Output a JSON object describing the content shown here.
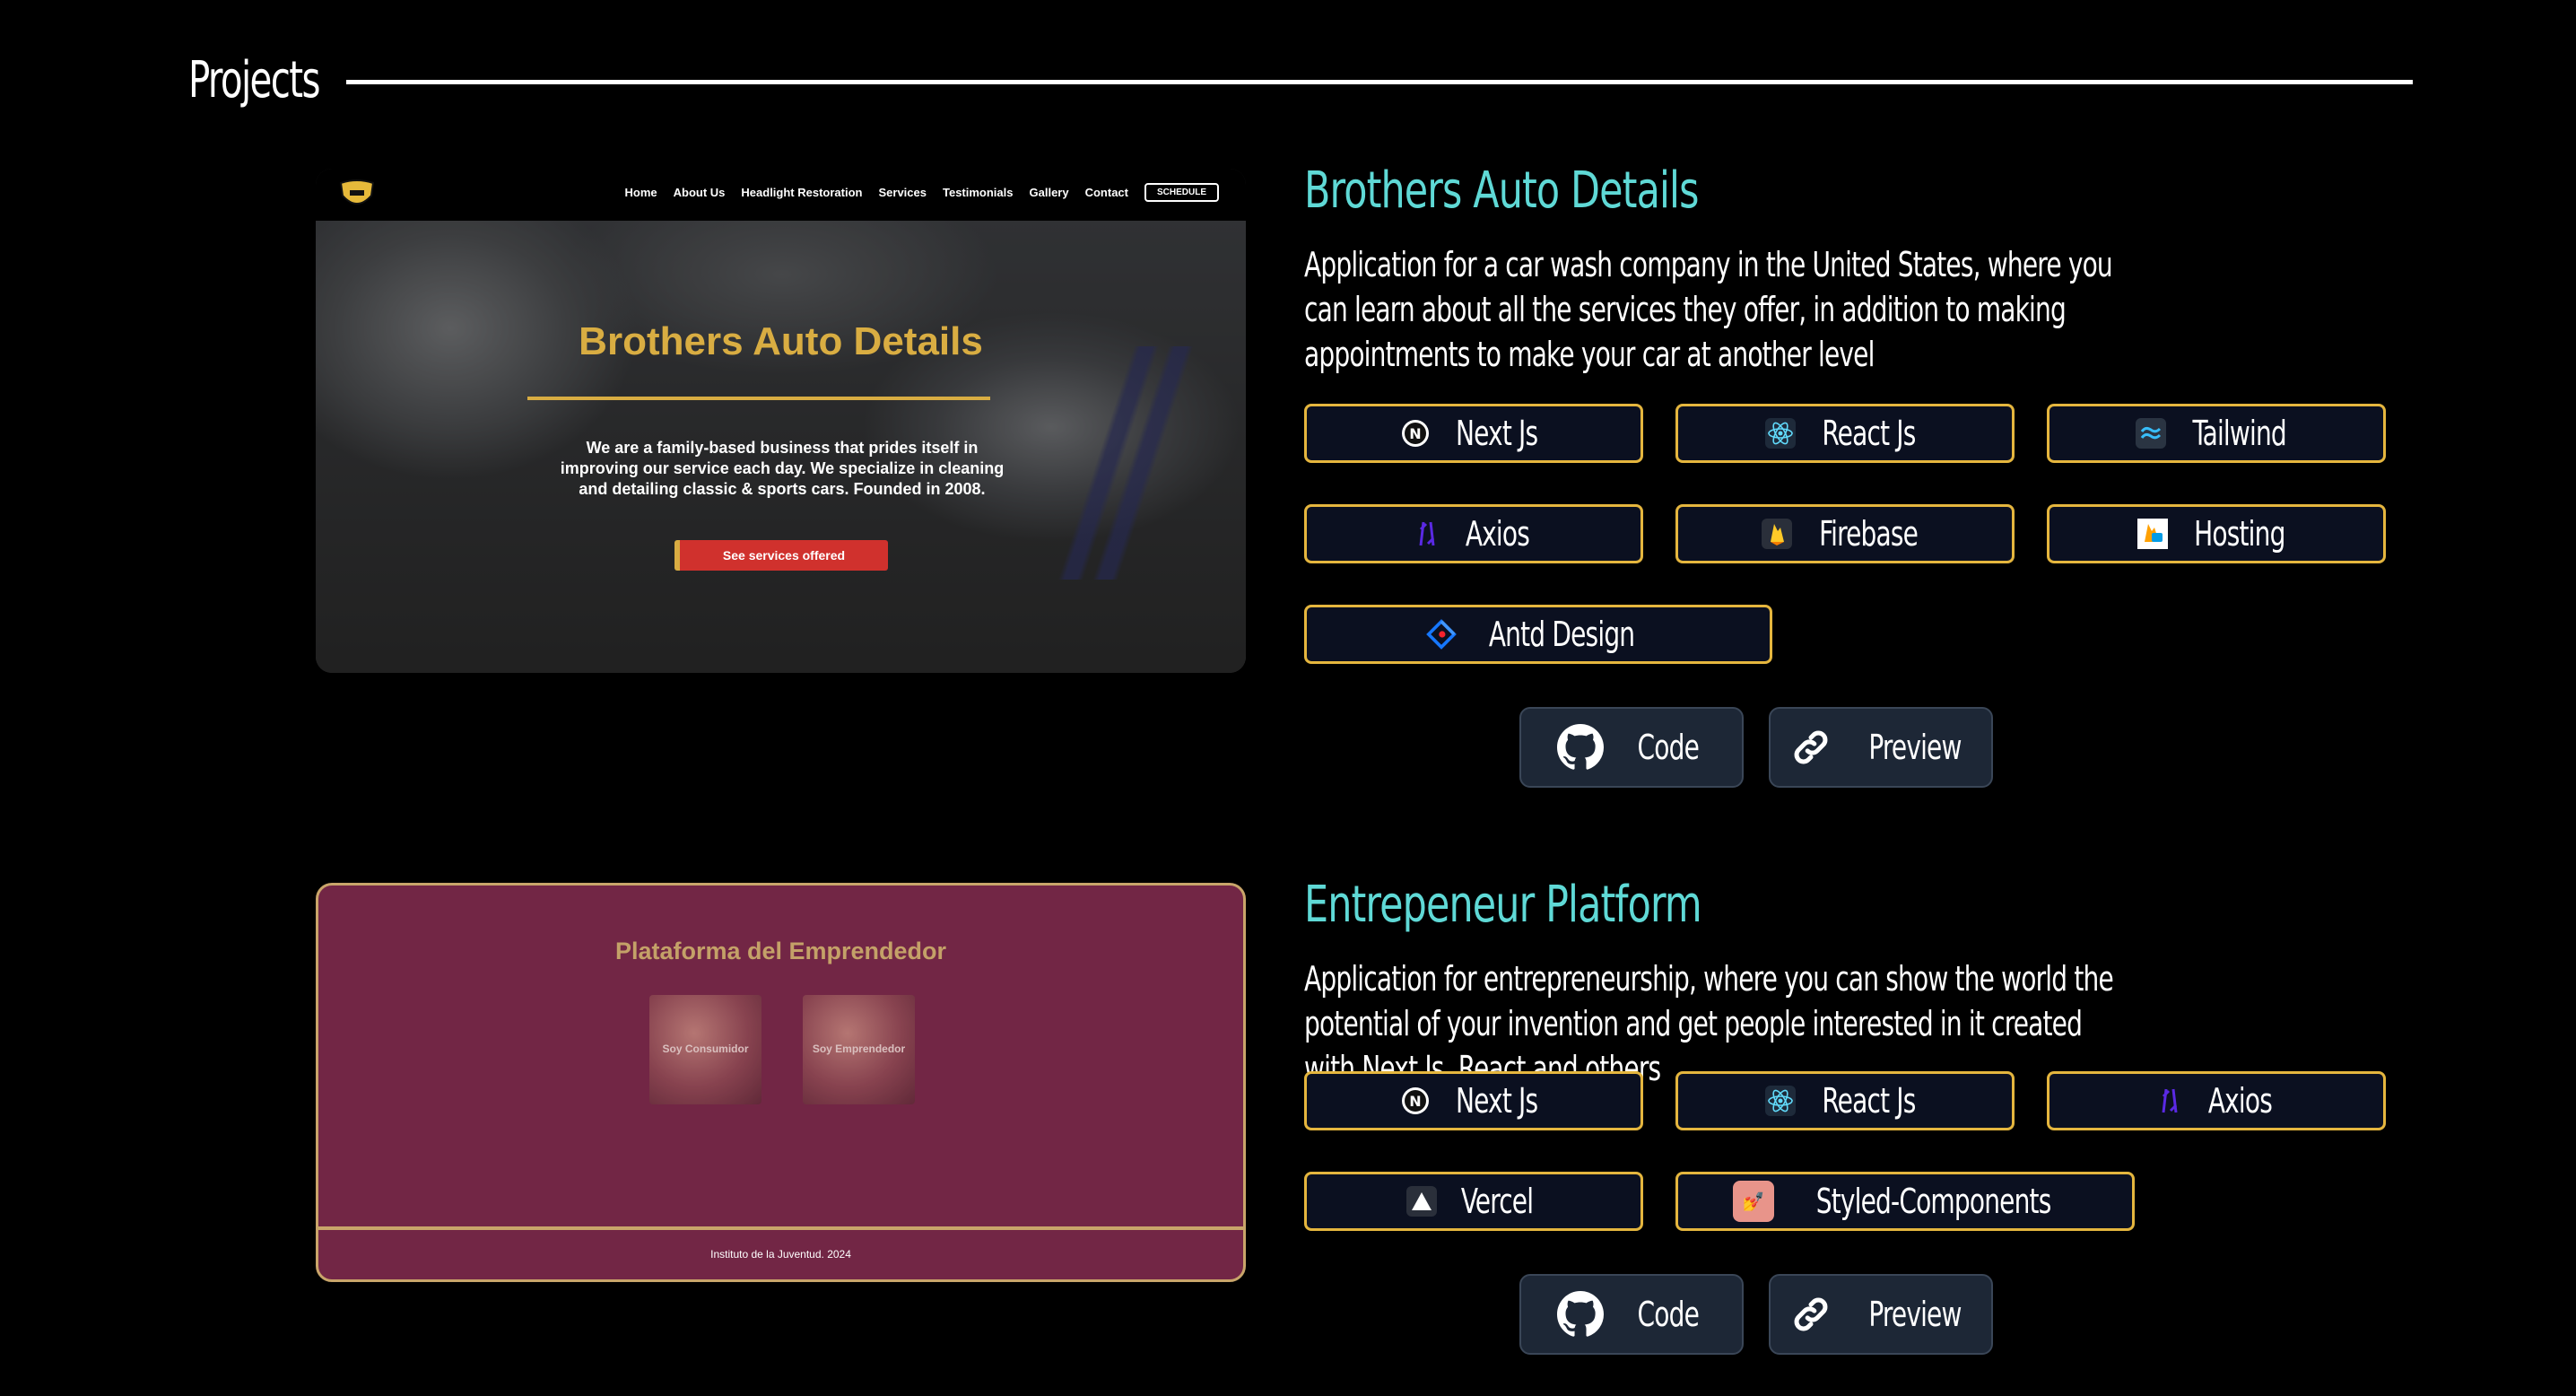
{
  "section": {
    "title": "Projects"
  },
  "projects": [
    {
      "title": "Brothers Auto Details",
      "description": "Application for a car wash company in the United States, where you can learn about all the services they offer, in addition to making appointments to make your car at another level",
      "tags": [
        "Next Js",
        "React Js",
        "Tailwind",
        "Axios",
        "Firebase",
        "Hosting",
        "Antd Design"
      ],
      "preview": {
        "nav": [
          "Home",
          "About Us",
          "Headlight Restoration",
          "Services",
          "Testimonials",
          "Gallery",
          "Contact"
        ],
        "nav_cta": "SCHEDULE",
        "hero_title": "Brothers Auto Details",
        "hero_text": "We are a family-based business that prides itself in improving our service each day. We specialize in cleaning and detailing classic & sports cars. Founded in 2008.",
        "hero_button": "See services offered"
      },
      "buttons": {
        "code": "Code",
        "preview": "Preview"
      }
    },
    {
      "title": "Entrepeneur Platform",
      "description": "Application for entrepreneurship, where you can show the world the potential of your invention and get people interested in it created with Next.Js, React and others",
      "tags": [
        "Next Js",
        "React Js",
        "Axios",
        "Vercel",
        "Styled-Components"
      ],
      "preview": {
        "title": "Plataforma del Emprendedor",
        "cards": [
          "Soy Consumidor",
          "Soy Emprendedor"
        ],
        "footer": "Instituto de la Juventud. 2024"
      },
      "buttons": {
        "code": "Code",
        "preview": "Preview"
      }
    }
  ],
  "colors": {
    "accent": "#5fd9d6",
    "tag_border": "#e5b63e",
    "tag_bg": "#0b1020",
    "button_bg": "#1d2736"
  }
}
